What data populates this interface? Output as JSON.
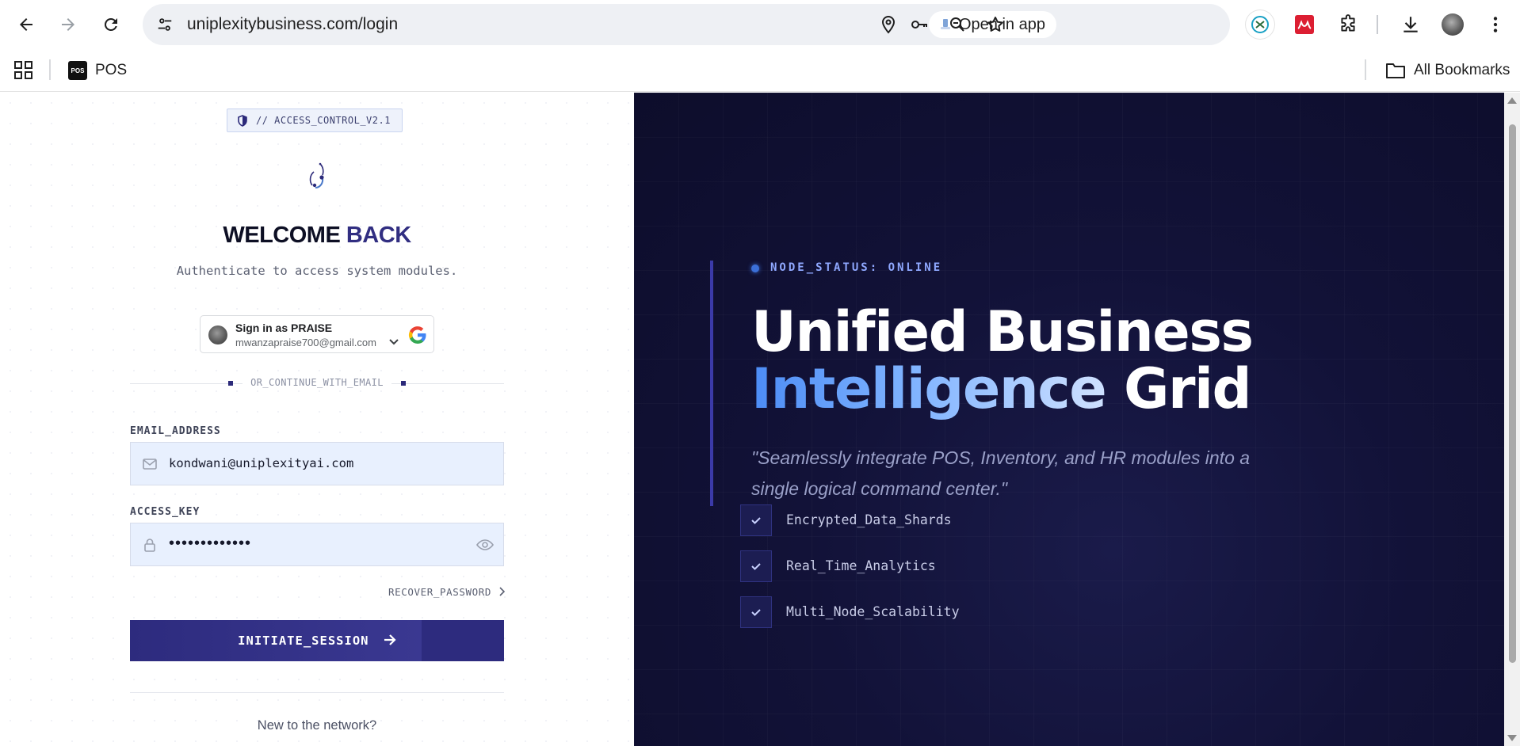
{
  "browser": {
    "url": "uniplexitybusiness.com/login",
    "open_in_app_label": "Open in app",
    "bookmarks": [
      {
        "label": "POS",
        "favicon_text": "POS"
      }
    ],
    "all_bookmarks_label": "All Bookmarks"
  },
  "login": {
    "badge": "// ACCESS_CONTROL_V2.1",
    "welcome_main": "WELCOME",
    "welcome_accent": "BACK",
    "subtitle": "Authenticate to access system modules.",
    "google": {
      "name": "Sign in as PRAISE",
      "email": "mwanzapraise700@gmail.com"
    },
    "divider_label": "OR_CONTINUE_WITH_EMAIL",
    "email_label": "EMAIL_ADDRESS",
    "email_value": "kondwani@uniplexityai.com",
    "password_label": "ACCESS_KEY",
    "password_mask": "•••••••••••••",
    "recover_label": "RECOVER_PASSWORD",
    "submit_label": "INITIATE_SESSION",
    "new_network": "New to the network?"
  },
  "hero": {
    "status": "NODE_STATUS: ONLINE",
    "headline_line1": "Unified Business",
    "headline_gradient": "Intelligence",
    "headline_rest": " Grid",
    "quote_line1": "\"Seamlessly integrate POS, Inventory, and HR modules into a",
    "quote_line2": "single logical command center.\"",
    "features": [
      "Encrypted_Data_Shards",
      "Real_Time_Analytics",
      "Multi_Node_Scalability"
    ]
  },
  "colors": {
    "brand": "#312e81",
    "hero_bg": "#121238",
    "accent_blue": "#7fb3ff"
  },
  "icons": [
    "back-icon",
    "forward-icon",
    "reload-icon",
    "site-info-icon",
    "location-icon",
    "key-icon",
    "zoom-icon",
    "star-icon",
    "extension-icon",
    "download-icon",
    "menu-icon",
    "apps-icon",
    "folder-icon",
    "shield-icon",
    "logo-icon",
    "mail-icon",
    "lock-icon",
    "eye-icon",
    "chevron-right-icon",
    "arrow-right-icon",
    "check-icon"
  ]
}
